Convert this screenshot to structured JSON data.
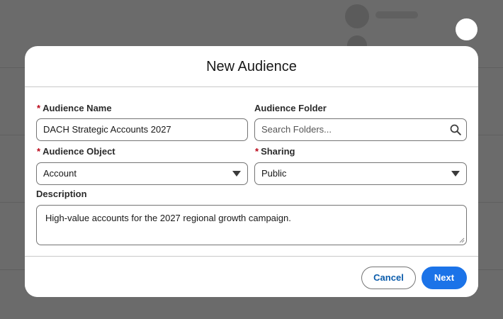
{
  "modal": {
    "title": "New Audience"
  },
  "form": {
    "required_marker": "*",
    "audience_name": {
      "label": "Audience Name",
      "value": "DACH Strategic Accounts 2027"
    },
    "audience_folder": {
      "label": "Audience Folder",
      "placeholder": "Search Folders..."
    },
    "audience_object": {
      "label": "Audience Object",
      "selected": "Account"
    },
    "sharing": {
      "label": "Sharing",
      "selected": "Public"
    },
    "description": {
      "label": "Description",
      "value": "High-value accounts for the 2027 regional growth campaign."
    }
  },
  "footer": {
    "cancel_label": "Cancel",
    "next_label": "Next"
  },
  "icons": {
    "close": "close-icon",
    "search": "search-icon",
    "dropdown": "chevron-down-icon"
  },
  "colors": {
    "overlay": "#6b6b6b",
    "required": "#ba0517",
    "brand": "#1b73e8",
    "link": "#0b5cab"
  }
}
